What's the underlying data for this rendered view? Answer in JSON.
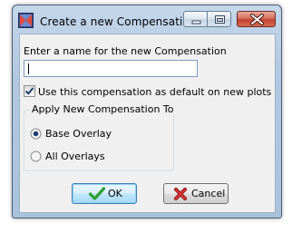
{
  "window": {
    "title": "Create  a new Compensati...",
    "app_icon": "compensation-app-icon",
    "controls": {
      "minimize_icon": "minimize-icon",
      "maximize_icon": "maximize-icon",
      "close_icon": "close-icon"
    }
  },
  "form": {
    "name_label": "Enter a name for the new Compensation",
    "name_value": "",
    "default_checkbox": {
      "label": "Use this compensation as default on new plots",
      "checked": true
    },
    "apply_group": {
      "caption": "Apply New Compensation To",
      "options": [
        {
          "label": "Base Overlay",
          "selected": true
        },
        {
          "label": "All Overlays",
          "selected": false
        }
      ]
    }
  },
  "buttons": {
    "ok_label": "OK",
    "ok_icon": "checkmark-icon",
    "cancel_label": "Cancel",
    "cancel_icon": "red-x-icon"
  },
  "colors": {
    "ok_check": "#2f9e2f",
    "cancel_x": "#c62828",
    "focus_border": "#3c7fb1"
  }
}
